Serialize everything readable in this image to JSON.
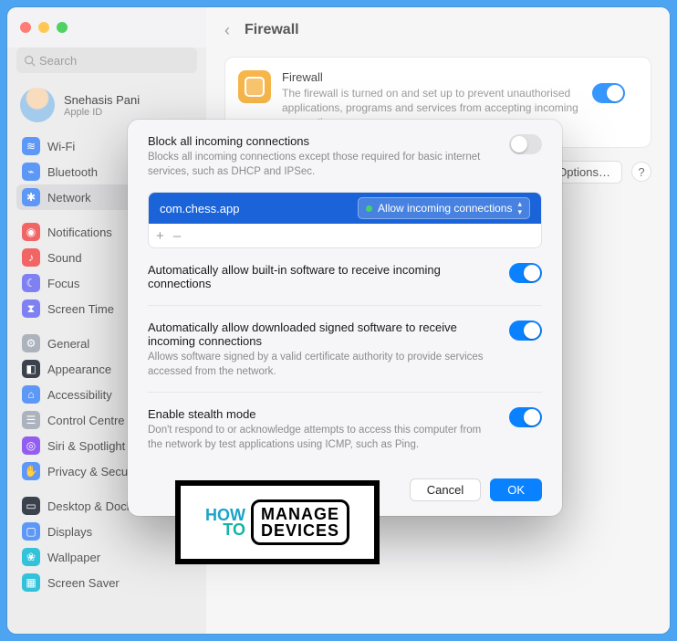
{
  "search_placeholder": "Search",
  "profile": {
    "name": "Snehasis Pani",
    "sub": "Apple ID"
  },
  "sidebar": {
    "groups": [
      [
        {
          "label": "Wi-Fi",
          "bg": "#3b82f6",
          "glyph": "≋"
        },
        {
          "label": "Bluetooth",
          "bg": "#3b82f6",
          "glyph": "⌁"
        },
        {
          "label": "Network",
          "bg": "#3b82f6",
          "glyph": "✱",
          "selected": true
        }
      ],
      [
        {
          "label": "Notifications",
          "bg": "#ef4444",
          "glyph": "◉"
        },
        {
          "label": "Sound",
          "bg": "#ef4444",
          "glyph": "♪"
        },
        {
          "label": "Focus",
          "bg": "#6366f1",
          "glyph": "☾"
        },
        {
          "label": "Screen Time",
          "bg": "#6366f1",
          "glyph": "⧗"
        }
      ],
      [
        {
          "label": "General",
          "bg": "#9ca3af",
          "glyph": "⚙"
        },
        {
          "label": "Appearance",
          "bg": "#111827",
          "glyph": "◧"
        },
        {
          "label": "Accessibility",
          "bg": "#3b82f6",
          "glyph": "⌂"
        },
        {
          "label": "Control Centre",
          "bg": "#9ca3af",
          "glyph": "☰"
        },
        {
          "label": "Siri & Spotlight",
          "bg": "#7c3aed",
          "glyph": "◎"
        },
        {
          "label": "Privacy & Security",
          "bg": "#3b82f6",
          "glyph": "✋"
        }
      ],
      [
        {
          "label": "Desktop & Dock",
          "bg": "#111827",
          "glyph": "▭"
        },
        {
          "label": "Displays",
          "bg": "#3b82f6",
          "glyph": "▢"
        },
        {
          "label": "Wallpaper",
          "bg": "#06b6d4",
          "glyph": "❀"
        },
        {
          "label": "Screen Saver",
          "bg": "#06b6d4",
          "glyph": "▦"
        }
      ]
    ]
  },
  "header": {
    "title": "Firewall"
  },
  "firewall_card": {
    "title": "Firewall",
    "desc": "The firewall is turned on and set up to prevent unauthorised applications, programs and services from accepting incoming connections."
  },
  "options_label": "Options…",
  "help_label": "?",
  "modal": {
    "block": {
      "title": "Block all incoming connections",
      "desc": "Blocks all incoming connections except those required for basic internet services, such as DHCP and IPSec."
    },
    "app": {
      "name": "com.chess.app",
      "rule": "Allow incoming connections"
    },
    "plus": "+",
    "minus": "–",
    "auto_builtin": {
      "title": "Automatically allow built-in software to receive incoming connections"
    },
    "auto_signed": {
      "title": "Automatically allow downloaded signed software to receive incoming connections",
      "desc": "Allows software signed by a valid certificate authority to provide services accessed from the network."
    },
    "stealth": {
      "title": "Enable stealth mode",
      "desc": "Don't respond to or acknowledge attempts to access this computer from the network by test applications using ICMP, such as Ping."
    },
    "cancel": "Cancel",
    "ok": "OK"
  },
  "watermark": {
    "how": "HOW",
    "to": "TO",
    "l1": "MANAGE",
    "l2": "DEVICES"
  }
}
